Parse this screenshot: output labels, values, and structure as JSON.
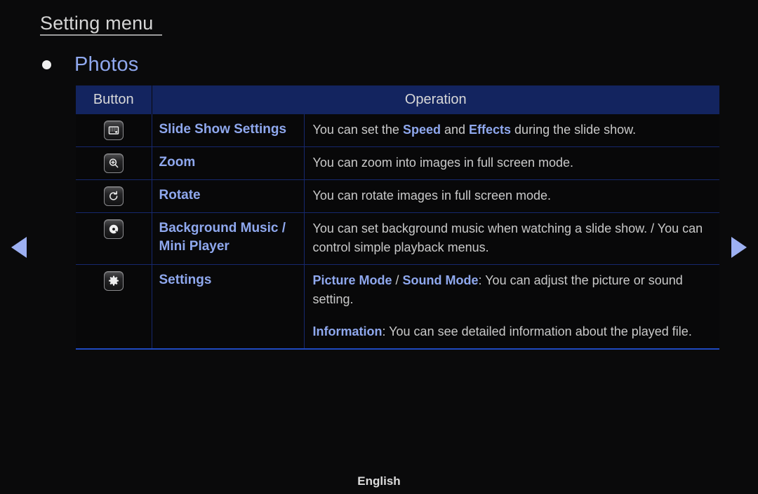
{
  "header": {
    "title": "Setting menu",
    "section_bullet": "bullet-dot",
    "section_title": "Photos"
  },
  "table": {
    "columns": [
      "Button",
      "Operation"
    ],
    "rows": [
      {
        "icon": "slideshow-icon",
        "name": "Slide Show Settings",
        "operation": [
          [
            {
              "t": "You can set the ",
              "hl": false
            },
            {
              "t": "Speed",
              "hl": true
            },
            {
              "t": " and ",
              "hl": false
            },
            {
              "t": "Effects",
              "hl": true
            },
            {
              "t": " during the slide show.",
              "hl": false
            }
          ]
        ]
      },
      {
        "icon": "zoom-in-icon",
        "name": "Zoom",
        "operation": [
          [
            {
              "t": "You can zoom into images in full screen mode.",
              "hl": false
            }
          ]
        ]
      },
      {
        "icon": "rotate-icon",
        "name": "Rotate",
        "operation": [
          [
            {
              "t": "You can rotate images in full screen mode.",
              "hl": false
            }
          ]
        ]
      },
      {
        "icon": "music-disc-icon",
        "name": "Background Music /\nMini Player",
        "operation": [
          [
            {
              "t": "You can set background music when watching a slide show. / You can control simple playback menus.",
              "hl": false
            }
          ]
        ]
      },
      {
        "icon": "gear-icon",
        "name": "Settings",
        "operation": [
          [
            {
              "t": "Picture Mode",
              "hl": true
            },
            {
              "t": " / ",
              "hl": false
            },
            {
              "t": "Sound Mode",
              "hl": true
            },
            {
              "t": ": You can adjust the picture or sound setting.",
              "hl": false
            }
          ],
          [
            {
              "t": "Information",
              "hl": true
            },
            {
              "t": ": You can see detailed information about the played file.",
              "hl": false
            }
          ]
        ]
      }
    ]
  },
  "nav": {
    "prev": "previous-page-arrow",
    "next": "next-page-arrow"
  },
  "footer": {
    "language": "English"
  },
  "colors": {
    "background": "#0a0a0b",
    "accent_blue": "#8fa8ee",
    "header_navy": "#13245f",
    "grid_line": "#16286e",
    "bottom_rule": "#1f49c0",
    "body_text": "#c9c9c9"
  }
}
